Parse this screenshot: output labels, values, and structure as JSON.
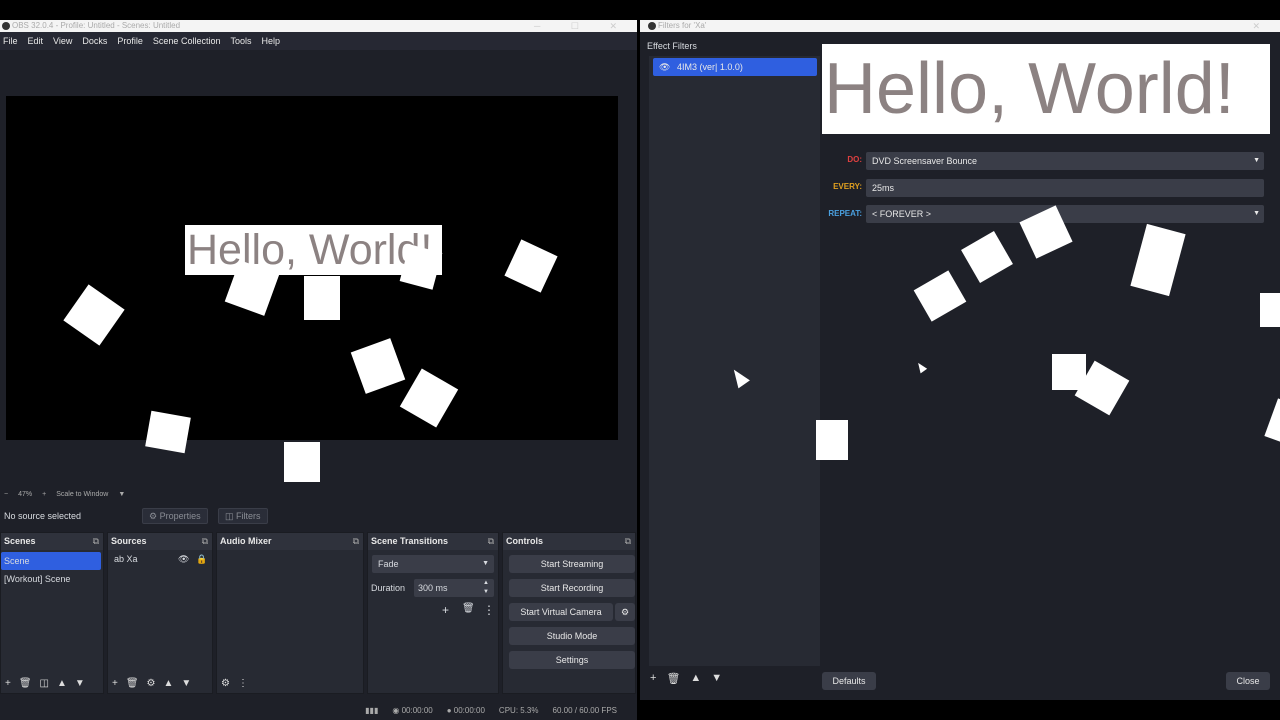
{
  "obs": {
    "title": "OBS 32.0.4 - Profile: Untitled - Scenes: Untitled",
    "menu": [
      "File",
      "Edit",
      "View",
      "Docks",
      "Profile",
      "Scene Collection",
      "Tools",
      "Help"
    ],
    "preview_text": "Hello, World!",
    "zoom": {
      "percent": "47%",
      "mode": "Scale to Window"
    },
    "source_bar": {
      "status": "No source selected",
      "properties": "Properties",
      "filters": "Filters"
    },
    "docks": {
      "scenes": {
        "title": "Scenes",
        "items": [
          "Scene",
          "[Workout] Scene"
        ]
      },
      "sources": {
        "title": "Sources",
        "items": [
          "Xa"
        ]
      },
      "audio_mixer": {
        "title": "Audio Mixer"
      },
      "transitions": {
        "title": "Scene Transitions",
        "type": "Fade",
        "duration_label": "Duration",
        "duration": "300 ms"
      },
      "controls": {
        "title": "Controls",
        "start_streaming": "Start Streaming",
        "start_recording": "Start Recording",
        "start_virtual_camera": "Start Virtual Camera",
        "studio_mode": "Studio Mode",
        "settings": "Settings"
      }
    },
    "status": {
      "stream_time": "00:00:00",
      "rec_time": "00:00:00",
      "cpu": "CPU: 5.3%",
      "fps": "60.00 / 60.00 FPS"
    }
  },
  "filters_window": {
    "title": "Filters for 'Xa'",
    "section": "Effect Filters",
    "filter_item": "4IM3 (ver| 1.0.0)",
    "preview_text": "Hello, World!",
    "props": {
      "do_label": "DO:",
      "do_value": "DVD Screensaver Bounce",
      "every_label": "EVERY:",
      "every_value": "25ms",
      "repeat_label": "REPEAT:",
      "repeat_value": "< FOREVER >"
    },
    "defaults": "Defaults",
    "close": "Close"
  },
  "colors": {
    "accent": "#2f5fe0",
    "do_label": "#e04040",
    "every_label": "#e0a020",
    "repeat_label": "#4aa0e0"
  }
}
